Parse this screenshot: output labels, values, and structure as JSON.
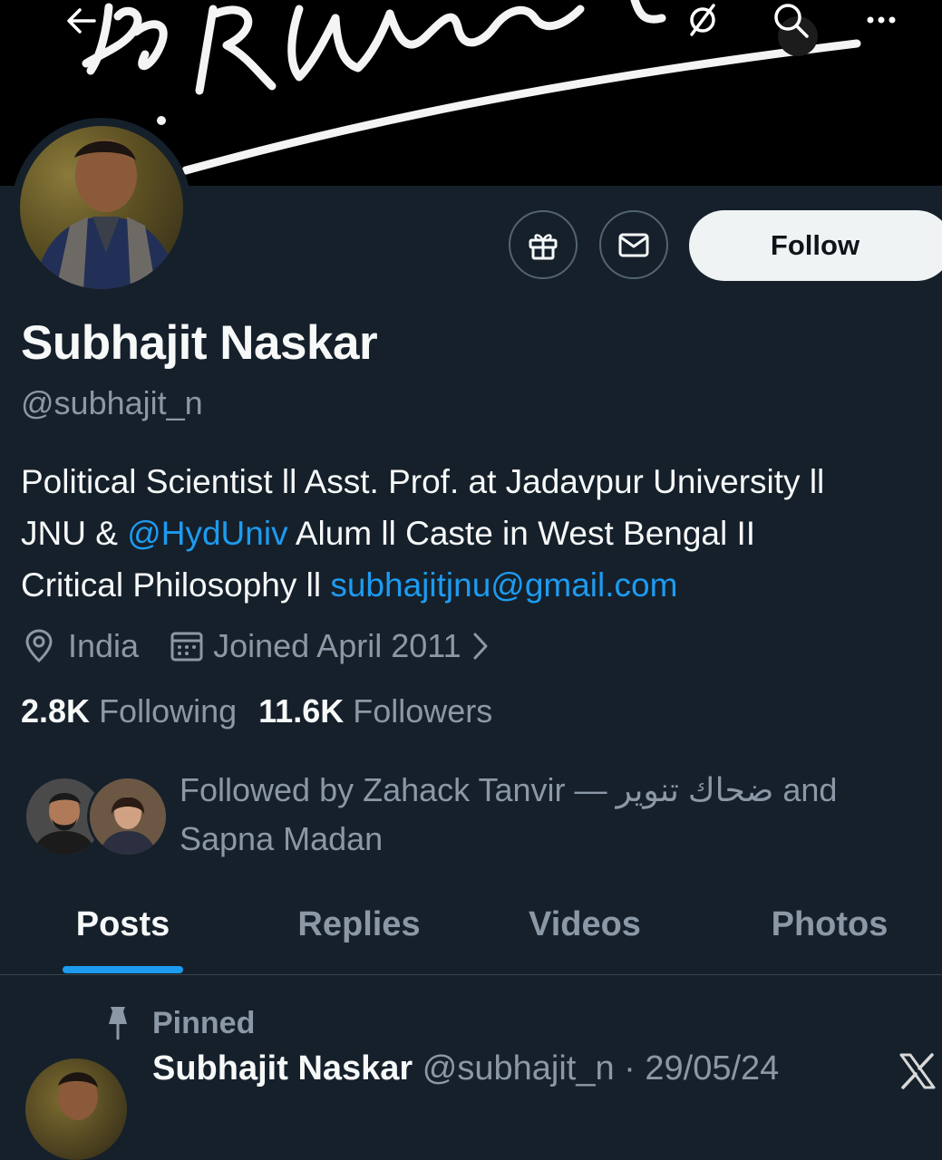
{
  "banner": {
    "description_icon": "signature-artwork"
  },
  "top_bar": {
    "back_icon": "arrow-left-icon",
    "hide_icon": "eye-off-icon",
    "search_icon": "search-icon",
    "more_icon": "more-horizontal-icon"
  },
  "actions": {
    "gift_icon": "gift-icon",
    "message_icon": "envelope-icon",
    "follow_label": "Follow"
  },
  "profile": {
    "name": "Subhajit Naskar",
    "handle": "@subhajit_n",
    "bio": {
      "line1": "Political Scientist ll Asst. Prof. at Jadavpur University ll",
      "line2_pre": "JNU & ",
      "line2_link": "@HydUniv",
      "line2_post": " Alum ll Caste in West Bengal II",
      "line3_pre": "Critical Philosophy ll ",
      "line3_link": "subhajitjnu@gmail.com"
    },
    "location": "India",
    "joined": "Joined April 2011"
  },
  "stats": {
    "following_count": "2.8K",
    "following_label": "Following",
    "followers_count": "11.6K",
    "followers_label": "Followers"
  },
  "followed_by": {
    "line1": "Followed by Zahack Tanvir — ضحاك تنوير and",
    "line2": "Sapna Madan"
  },
  "tabs": [
    {
      "label": "Posts",
      "active": true
    },
    {
      "label": "Replies",
      "active": false
    },
    {
      "label": "Videos",
      "active": false
    },
    {
      "label": "Photos",
      "active": false
    }
  ],
  "pinned_post": {
    "pinned_label": "Pinned",
    "author_name": "Subhajit Naskar",
    "author_handle_date": "@subhajit_n · 29/05/24"
  },
  "colors": {
    "background": "#15202b",
    "accent": "#1d9bf0",
    "secondary_text": "#8b98a5",
    "primary_text": "#f7f9f9"
  }
}
